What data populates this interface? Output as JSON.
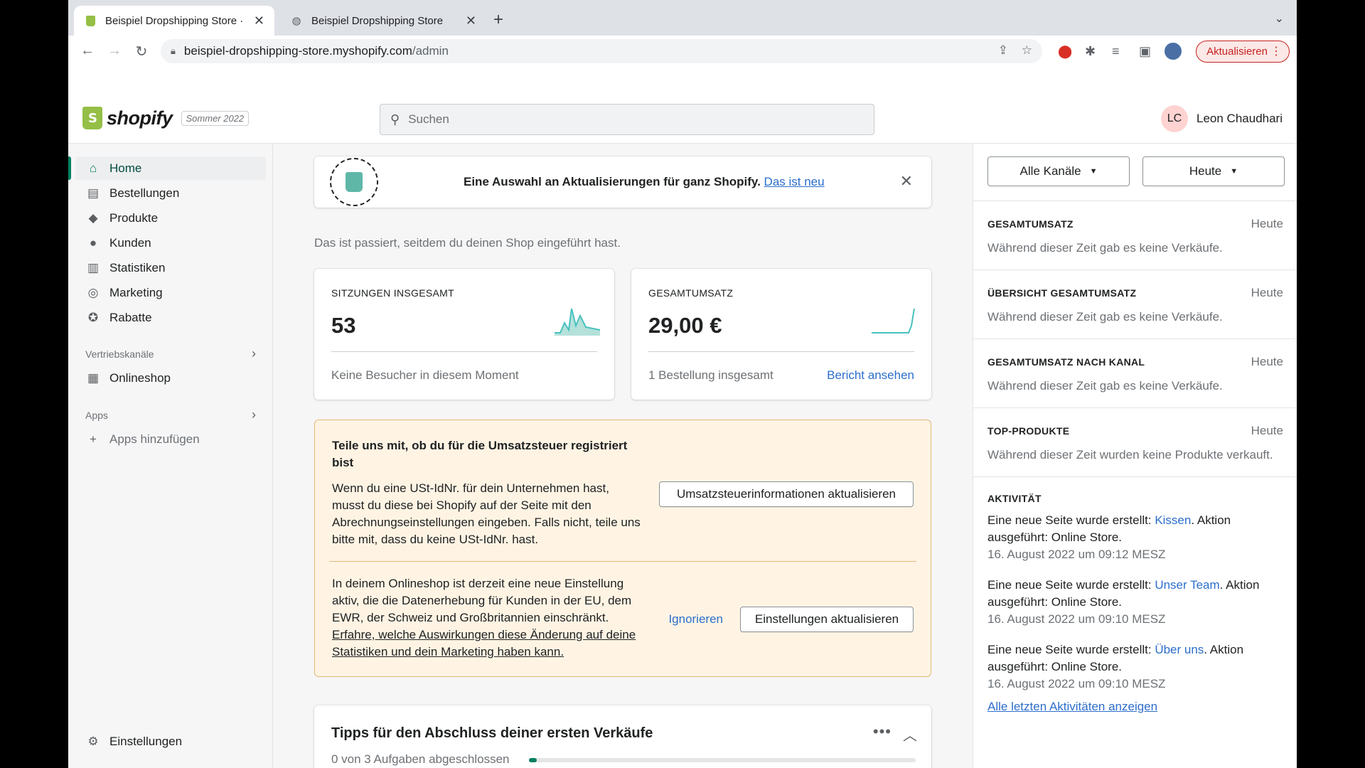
{
  "browser": {
    "tabs": [
      {
        "title": "Beispiel Dropshipping Store · H",
        "active": true
      },
      {
        "title": "Beispiel Dropshipping Store",
        "active": false
      }
    ],
    "url_host": "beispiel-dropshipping-store.myshopify.com",
    "url_path": "/admin",
    "update_label": "Aktualisieren"
  },
  "header": {
    "logo": "shopify",
    "edition": "Sommer 2022",
    "search_placeholder": "Suchen",
    "user_initials": "LC",
    "user_name": "Leon Chaudhari"
  },
  "sidebar": {
    "items": [
      {
        "label": "Home",
        "icon": "home-icon",
        "active": true
      },
      {
        "label": "Bestellungen",
        "icon": "orders-icon"
      },
      {
        "label": "Produkte",
        "icon": "tag-icon"
      },
      {
        "label": "Kunden",
        "icon": "person-icon"
      },
      {
        "label": "Statistiken",
        "icon": "bar-chart-icon"
      },
      {
        "label": "Marketing",
        "icon": "target-icon"
      },
      {
        "label": "Rabatte",
        "icon": "discount-icon"
      }
    ],
    "sales_channels_label": "Vertriebskanäle",
    "online_store": "Onlineshop",
    "apps_label": "Apps",
    "add_apps": "Apps hinzufügen",
    "settings": "Einstellungen"
  },
  "banner": {
    "message": "Eine Auswahl an Aktualisierungen für ganz Shopify.",
    "link": "Das ist neu"
  },
  "main": {
    "subtitle": "Das ist passiert, seitdem du deinen Shop eingeführt hast.",
    "metrics": [
      {
        "label": "SITZUNGEN INSGESAMT",
        "value": "53",
        "footer": "Keine Besucher in diesem Moment"
      },
      {
        "label": "GESAMTUMSATZ",
        "value": "29,00 €",
        "footer": "1 Bestellung insgesamt",
        "link": "Bericht ansehen"
      }
    ],
    "vat": {
      "heading": "Teile uns mit, ob du für die Umsatzsteuer registriert bist",
      "text": "Wenn du eine USt-IdNr. für dein Unternehmen hast, musst du diese bei Shopify auf der Seite mit den Abrechnungseinstellungen eingeben. Falls nicht, teile uns bitte mit, dass du keine USt-IdNr. hast.",
      "button": "Umsatzsteuerinformationen aktualisieren",
      "text2": "In deinem Onlineshop ist derzeit eine neue Einstellung aktiv, die die Datenerhebung für Kunden in der EU, dem EWR, der Schweiz und Großbritannien einschränkt.",
      "text2_link": "Erfahre, welche Auswirkungen diese Änderung auf deine Statistiken und dein Marketing haben kann.",
      "ignore": "Ignorieren",
      "button2": "Einstellungen aktualisieren"
    },
    "tips": {
      "title": "Tipps für den Abschluss deiner ersten Verkäufe",
      "status": "0 von 3 Aufgaben abgeschlossen",
      "progress": 0.02
    }
  },
  "right": {
    "channel_select": "Alle Kanäle",
    "date_select": "Heute",
    "sections": [
      {
        "title": "GESAMTUMSATZ",
        "date": "Heute",
        "message": "Während dieser Zeit gab es keine Verkäufe."
      },
      {
        "title": "ÜBERSICHT GESAMTUMSATZ",
        "date": "Heute",
        "message": "Während dieser Zeit gab es keine Verkäufe."
      },
      {
        "title": "GESAMTUMSATZ NACH KANAL",
        "date": "Heute",
        "message": "Während dieser Zeit gab es keine Verkäufe."
      },
      {
        "title": "TOP-PRODUKTE",
        "date": "Heute",
        "message": "Während dieser Zeit wurden keine Produkte verkauft."
      }
    ],
    "activity_title": "AKTIVITÄT",
    "activities": [
      {
        "prefix": "Eine neue Seite wurde erstellt: ",
        "link": "Kissen",
        "suffix": ". Aktion ausgeführt: Online Store.",
        "time": "16. August 2022 um 09:12 MESZ"
      },
      {
        "prefix": "Eine neue Seite wurde erstellt: ",
        "link": "Unser Team",
        "suffix": ". Aktion ausgeführt: Online Store.",
        "time": "16. August 2022 um 09:10 MESZ"
      },
      {
        "prefix": "Eine neue Seite wurde erstellt: ",
        "link": "Über uns",
        "suffix": ". Aktion ausgeführt: Online Store.",
        "time": "16. August 2022 um 09:10 MESZ"
      }
    ],
    "all_activities": "Alle letzten Aktivitäten anzeigen"
  }
}
